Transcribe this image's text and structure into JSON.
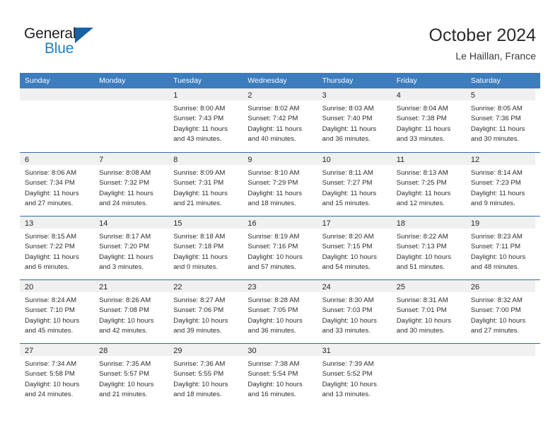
{
  "brand": {
    "name_part1": "General",
    "name_part2": "Blue",
    "triangle_icon": "triangle-icon",
    "accent_color": "#1f7fc4"
  },
  "header": {
    "title": "October 2024",
    "location": "Le Haillan, France"
  },
  "theme": {
    "header_blue": "#3d7cbd",
    "row_divider_blue": "#2e6da8",
    "date_strip_gray": "#f0f0f0",
    "text_dark": "#2d2d2d"
  },
  "weekdays": [
    "Sunday",
    "Monday",
    "Tuesday",
    "Wednesday",
    "Thursday",
    "Friday",
    "Saturday"
  ],
  "labels": {
    "sunrise_prefix": "Sunrise:",
    "sunset_prefix": "Sunset:",
    "daylight_prefix": "Daylight:"
  },
  "weeks": [
    [
      {
        "day": "",
        "empty": true
      },
      {
        "day": "",
        "empty": true
      },
      {
        "day": "1",
        "line1": "Sunrise: 8:00 AM",
        "line2": "Sunset: 7:43 PM",
        "line3": "Daylight: 11 hours",
        "line4": "and 43 minutes."
      },
      {
        "day": "2",
        "line1": "Sunrise: 8:02 AM",
        "line2": "Sunset: 7:42 PM",
        "line3": "Daylight: 11 hours",
        "line4": "and 40 minutes."
      },
      {
        "day": "3",
        "line1": "Sunrise: 8:03 AM",
        "line2": "Sunset: 7:40 PM",
        "line3": "Daylight: 11 hours",
        "line4": "and 36 minutes."
      },
      {
        "day": "4",
        "line1": "Sunrise: 8:04 AM",
        "line2": "Sunset: 7:38 PM",
        "line3": "Daylight: 11 hours",
        "line4": "and 33 minutes."
      },
      {
        "day": "5",
        "line1": "Sunrise: 8:05 AM",
        "line2": "Sunset: 7:36 PM",
        "line3": "Daylight: 11 hours",
        "line4": "and 30 minutes."
      }
    ],
    [
      {
        "day": "6",
        "line1": "Sunrise: 8:06 AM",
        "line2": "Sunset: 7:34 PM",
        "line3": "Daylight: 11 hours",
        "line4": "and 27 minutes."
      },
      {
        "day": "7",
        "line1": "Sunrise: 8:08 AM",
        "line2": "Sunset: 7:32 PM",
        "line3": "Daylight: 11 hours",
        "line4": "and 24 minutes."
      },
      {
        "day": "8",
        "line1": "Sunrise: 8:09 AM",
        "line2": "Sunset: 7:31 PM",
        "line3": "Daylight: 11 hours",
        "line4": "and 21 minutes."
      },
      {
        "day": "9",
        "line1": "Sunrise: 8:10 AM",
        "line2": "Sunset: 7:29 PM",
        "line3": "Daylight: 11 hours",
        "line4": "and 18 minutes."
      },
      {
        "day": "10",
        "line1": "Sunrise: 8:11 AM",
        "line2": "Sunset: 7:27 PM",
        "line3": "Daylight: 11 hours",
        "line4": "and 15 minutes."
      },
      {
        "day": "11",
        "line1": "Sunrise: 8:13 AM",
        "line2": "Sunset: 7:25 PM",
        "line3": "Daylight: 11 hours",
        "line4": "and 12 minutes."
      },
      {
        "day": "12",
        "line1": "Sunrise: 8:14 AM",
        "line2": "Sunset: 7:23 PM",
        "line3": "Daylight: 11 hours",
        "line4": "and 9 minutes."
      }
    ],
    [
      {
        "day": "13",
        "line1": "Sunrise: 8:15 AM",
        "line2": "Sunset: 7:22 PM",
        "line3": "Daylight: 11 hours",
        "line4": "and 6 minutes."
      },
      {
        "day": "14",
        "line1": "Sunrise: 8:17 AM",
        "line2": "Sunset: 7:20 PM",
        "line3": "Daylight: 11 hours",
        "line4": "and 3 minutes."
      },
      {
        "day": "15",
        "line1": "Sunrise: 8:18 AM",
        "line2": "Sunset: 7:18 PM",
        "line3": "Daylight: 11 hours",
        "line4": "and 0 minutes."
      },
      {
        "day": "16",
        "line1": "Sunrise: 8:19 AM",
        "line2": "Sunset: 7:16 PM",
        "line3": "Daylight: 10 hours",
        "line4": "and 57 minutes."
      },
      {
        "day": "17",
        "line1": "Sunrise: 8:20 AM",
        "line2": "Sunset: 7:15 PM",
        "line3": "Daylight: 10 hours",
        "line4": "and 54 minutes."
      },
      {
        "day": "18",
        "line1": "Sunrise: 8:22 AM",
        "line2": "Sunset: 7:13 PM",
        "line3": "Daylight: 10 hours",
        "line4": "and 51 minutes."
      },
      {
        "day": "19",
        "line1": "Sunrise: 8:23 AM",
        "line2": "Sunset: 7:11 PM",
        "line3": "Daylight: 10 hours",
        "line4": "and 48 minutes."
      }
    ],
    [
      {
        "day": "20",
        "line1": "Sunrise: 8:24 AM",
        "line2": "Sunset: 7:10 PM",
        "line3": "Daylight: 10 hours",
        "line4": "and 45 minutes."
      },
      {
        "day": "21",
        "line1": "Sunrise: 8:26 AM",
        "line2": "Sunset: 7:08 PM",
        "line3": "Daylight: 10 hours",
        "line4": "and 42 minutes."
      },
      {
        "day": "22",
        "line1": "Sunrise: 8:27 AM",
        "line2": "Sunset: 7:06 PM",
        "line3": "Daylight: 10 hours",
        "line4": "and 39 minutes."
      },
      {
        "day": "23",
        "line1": "Sunrise: 8:28 AM",
        "line2": "Sunset: 7:05 PM",
        "line3": "Daylight: 10 hours",
        "line4": "and 36 minutes."
      },
      {
        "day": "24",
        "line1": "Sunrise: 8:30 AM",
        "line2": "Sunset: 7:03 PM",
        "line3": "Daylight: 10 hours",
        "line4": "and 33 minutes."
      },
      {
        "day": "25",
        "line1": "Sunrise: 8:31 AM",
        "line2": "Sunset: 7:01 PM",
        "line3": "Daylight: 10 hours",
        "line4": "and 30 minutes."
      },
      {
        "day": "26",
        "line1": "Sunrise: 8:32 AM",
        "line2": "Sunset: 7:00 PM",
        "line3": "Daylight: 10 hours",
        "line4": "and 27 minutes."
      }
    ],
    [
      {
        "day": "27",
        "line1": "Sunrise: 7:34 AM",
        "line2": "Sunset: 5:58 PM",
        "line3": "Daylight: 10 hours",
        "line4": "and 24 minutes."
      },
      {
        "day": "28",
        "line1": "Sunrise: 7:35 AM",
        "line2": "Sunset: 5:57 PM",
        "line3": "Daylight: 10 hours",
        "line4": "and 21 minutes."
      },
      {
        "day": "29",
        "line1": "Sunrise: 7:36 AM",
        "line2": "Sunset: 5:55 PM",
        "line3": "Daylight: 10 hours",
        "line4": "and 18 minutes."
      },
      {
        "day": "30",
        "line1": "Sunrise: 7:38 AM",
        "line2": "Sunset: 5:54 PM",
        "line3": "Daylight: 10 hours",
        "line4": "and 16 minutes."
      },
      {
        "day": "31",
        "line1": "Sunrise: 7:39 AM",
        "line2": "Sunset: 5:52 PM",
        "line3": "Daylight: 10 hours",
        "line4": "and 13 minutes."
      },
      {
        "day": "",
        "empty": true
      },
      {
        "day": "",
        "empty": true
      }
    ]
  ]
}
